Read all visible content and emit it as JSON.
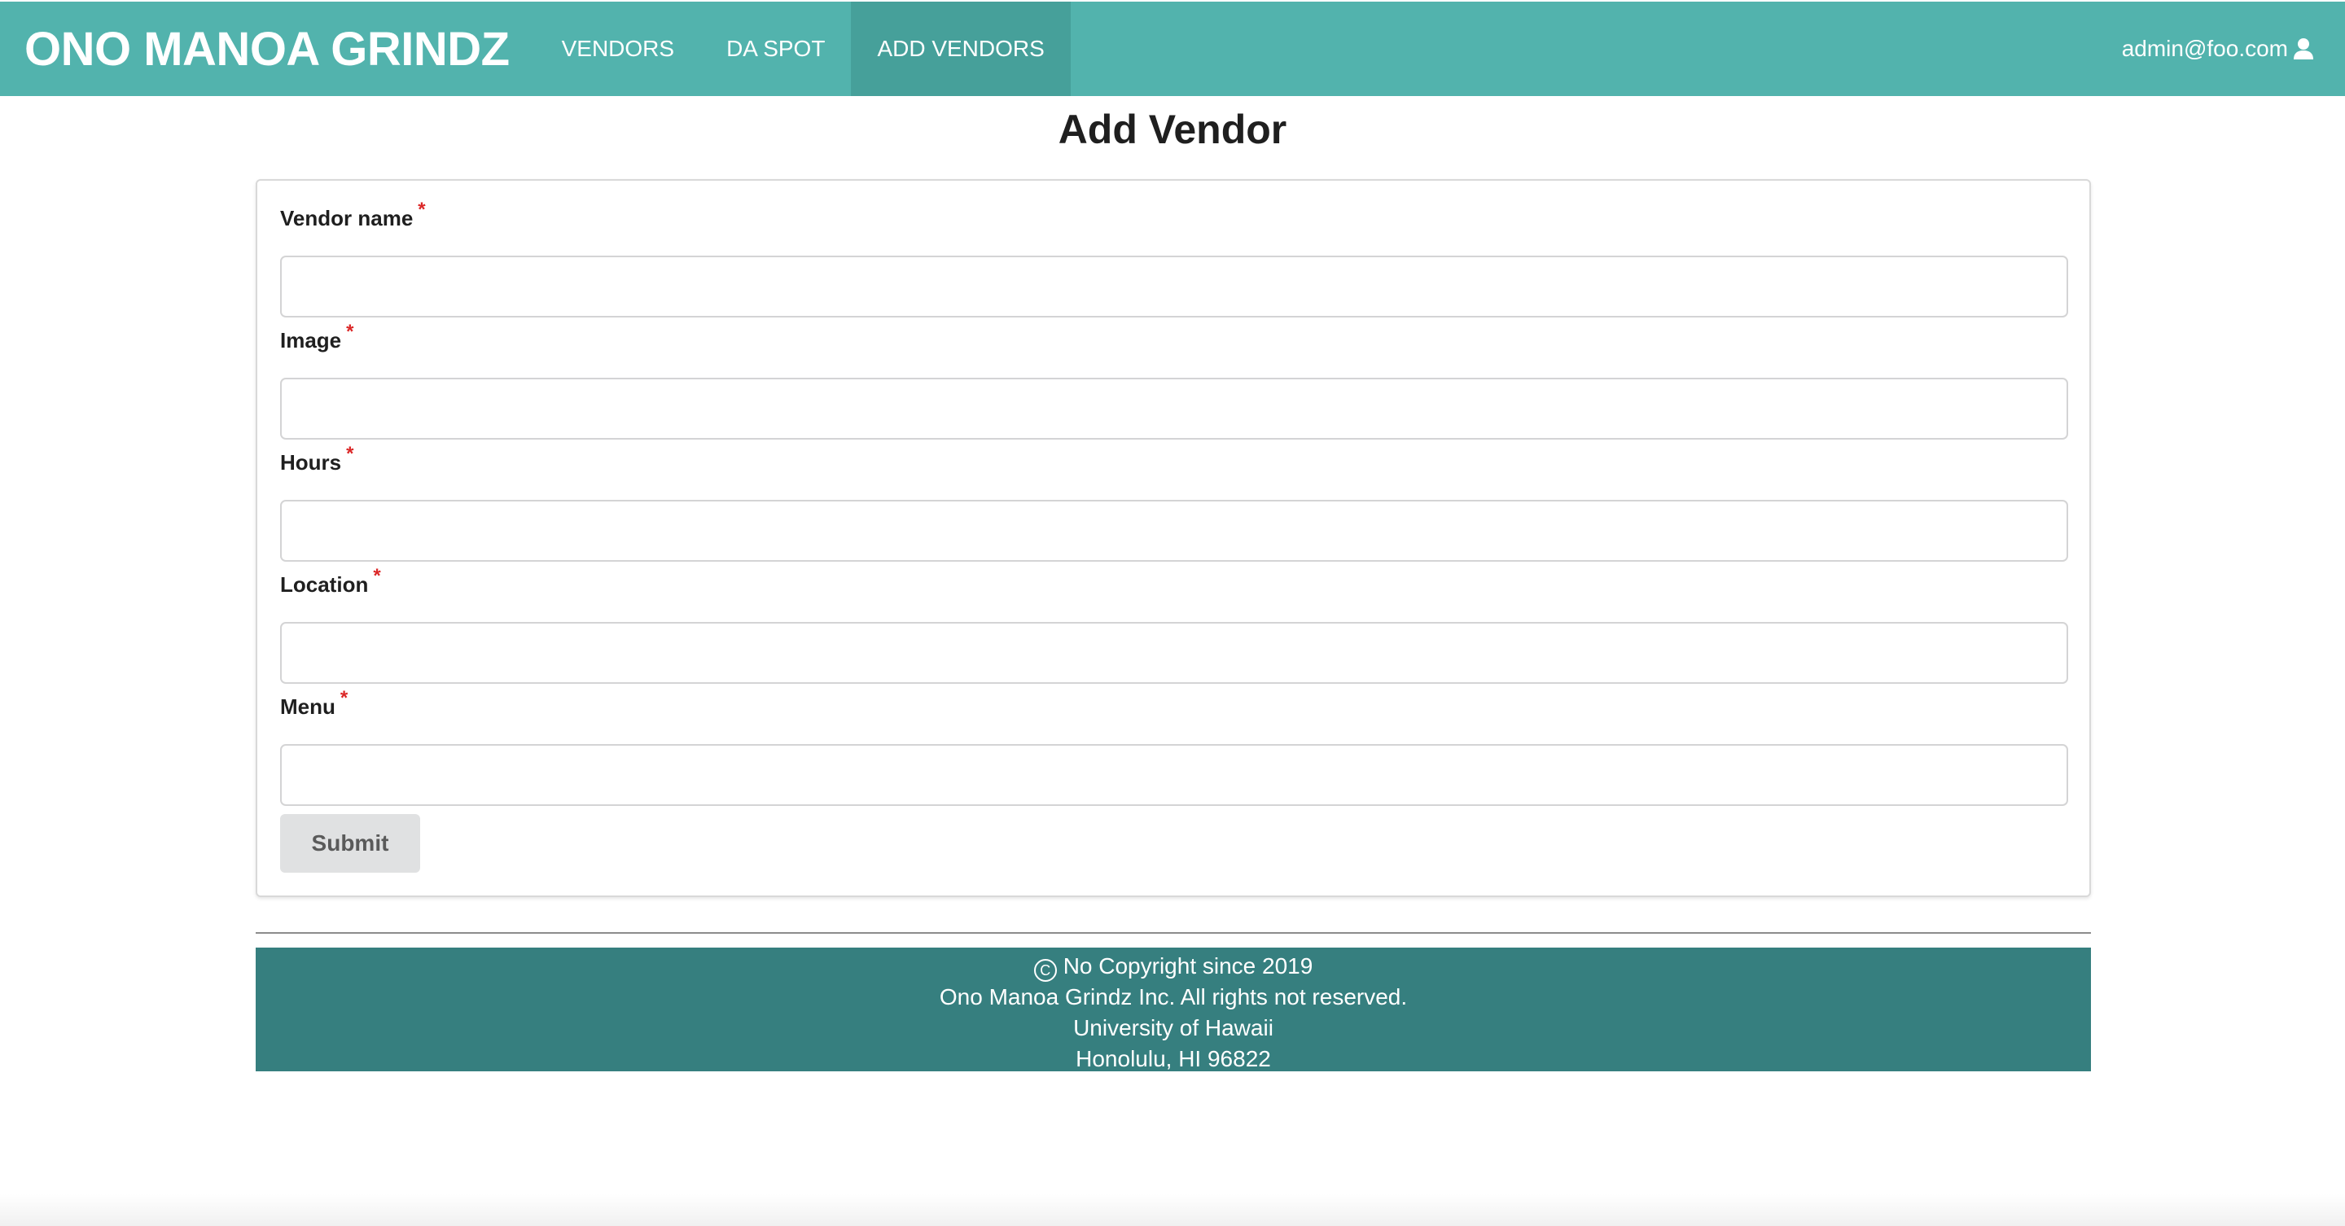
{
  "navbar": {
    "brand": "ONO MANOA GRINDZ",
    "items": [
      {
        "label": "VENDORS",
        "active": false
      },
      {
        "label": "DA SPOT",
        "active": false
      },
      {
        "label": "ADD VENDORS",
        "active": true
      }
    ],
    "user_email": "admin@foo.com",
    "user_icon": "user-icon"
  },
  "page": {
    "title": "Add Vendor"
  },
  "form": {
    "required_marker": "*",
    "fields": [
      {
        "label": "Vendor name",
        "value": "",
        "placeholder": ""
      },
      {
        "label": "Image",
        "value": "",
        "placeholder": ""
      },
      {
        "label": "Hours",
        "value": "",
        "placeholder": ""
      },
      {
        "label": "Location",
        "value": "",
        "placeholder": ""
      },
      {
        "label": "Menu",
        "value": "",
        "placeholder": ""
      }
    ],
    "submit_label": "Submit"
  },
  "footer": {
    "copyright_symbol": "C",
    "line1": "No Copyright since 2019",
    "line2": "Ono Manoa Grindz Inc. All rights not reserved.",
    "line3": "University of Hawaii",
    "line4": "Honolulu, HI 96822"
  },
  "colors": {
    "navbar": "#52b3ad",
    "navbar_active": "#46a09a",
    "footer": "#367f7f",
    "required": "#db2828",
    "button": "#e0e1e2"
  }
}
